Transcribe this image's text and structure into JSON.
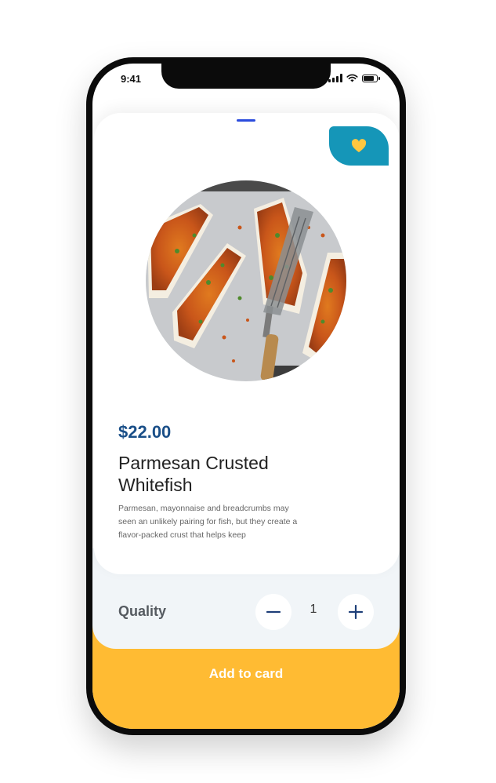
{
  "status_bar": {
    "time": "9:41",
    "icons": [
      "signal-icon",
      "wifi-icon",
      "battery-icon"
    ]
  },
  "product": {
    "price": "$22.00",
    "title": "Parmesan Crusted Whitefish",
    "description": "Parmesan, mayonnaise and breadcrumbs may seen an unlikely pairing for fish, but they create a flavor-packed crust that helps keep",
    "image_icon": "product-photo-whitefish"
  },
  "favorite": {
    "icon": "heart-icon",
    "color": "#ffc740",
    "background": "#1596b8"
  },
  "quantity": {
    "label": "Quality",
    "value": "1",
    "minus_icon": "minus-icon",
    "plus_icon": "plus-icon"
  },
  "cta": {
    "label": "Add to card",
    "color": "#ffbb33"
  },
  "colors": {
    "price": "#1a4f88",
    "accent_handle": "#2b4cdd"
  }
}
